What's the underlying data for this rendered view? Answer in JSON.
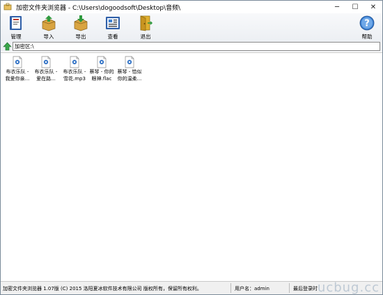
{
  "window": {
    "title": "加密文件夹浏览器 - C:\\Users\\dogoodsoft\\Desktop\\音频\\",
    "controls": {
      "minimize": "─",
      "maximize": "☐",
      "close": "✕"
    }
  },
  "toolbar": {
    "manage": "管理",
    "import": "导入",
    "export": "导出",
    "view": "查看",
    "exit": "退出",
    "help": "帮助"
  },
  "address": {
    "value": "加密区:\\"
  },
  "files": [
    {
      "line1": "布衣乐队 -",
      "line2": "我爱你亲..."
    },
    {
      "line1": "布衣乐队 -",
      "line2": "爱在路..."
    },
    {
      "line1": "布衣乐队 -",
      "line2": "雪花.mp3"
    },
    {
      "line1": "蔡琴 - 你的",
      "line2": "眼神.flac"
    },
    {
      "line1": "蔡琴 - 恰似",
      "line2": "你的温柔..."
    }
  ],
  "status": {
    "copyright": "加密文件夹浏览器 1.07版 (C) 2015 洛阳夏冰软件技术有限公司 版权所有，保留所有权利。",
    "user": "用户名：admin",
    "login": "最后登录时",
    "watermark": "ucbug.cc"
  },
  "colors": {
    "file_icon_accent": "#3a78c8",
    "address_arrow": "#3aa64a",
    "help_icon": "#3b7fd0"
  }
}
